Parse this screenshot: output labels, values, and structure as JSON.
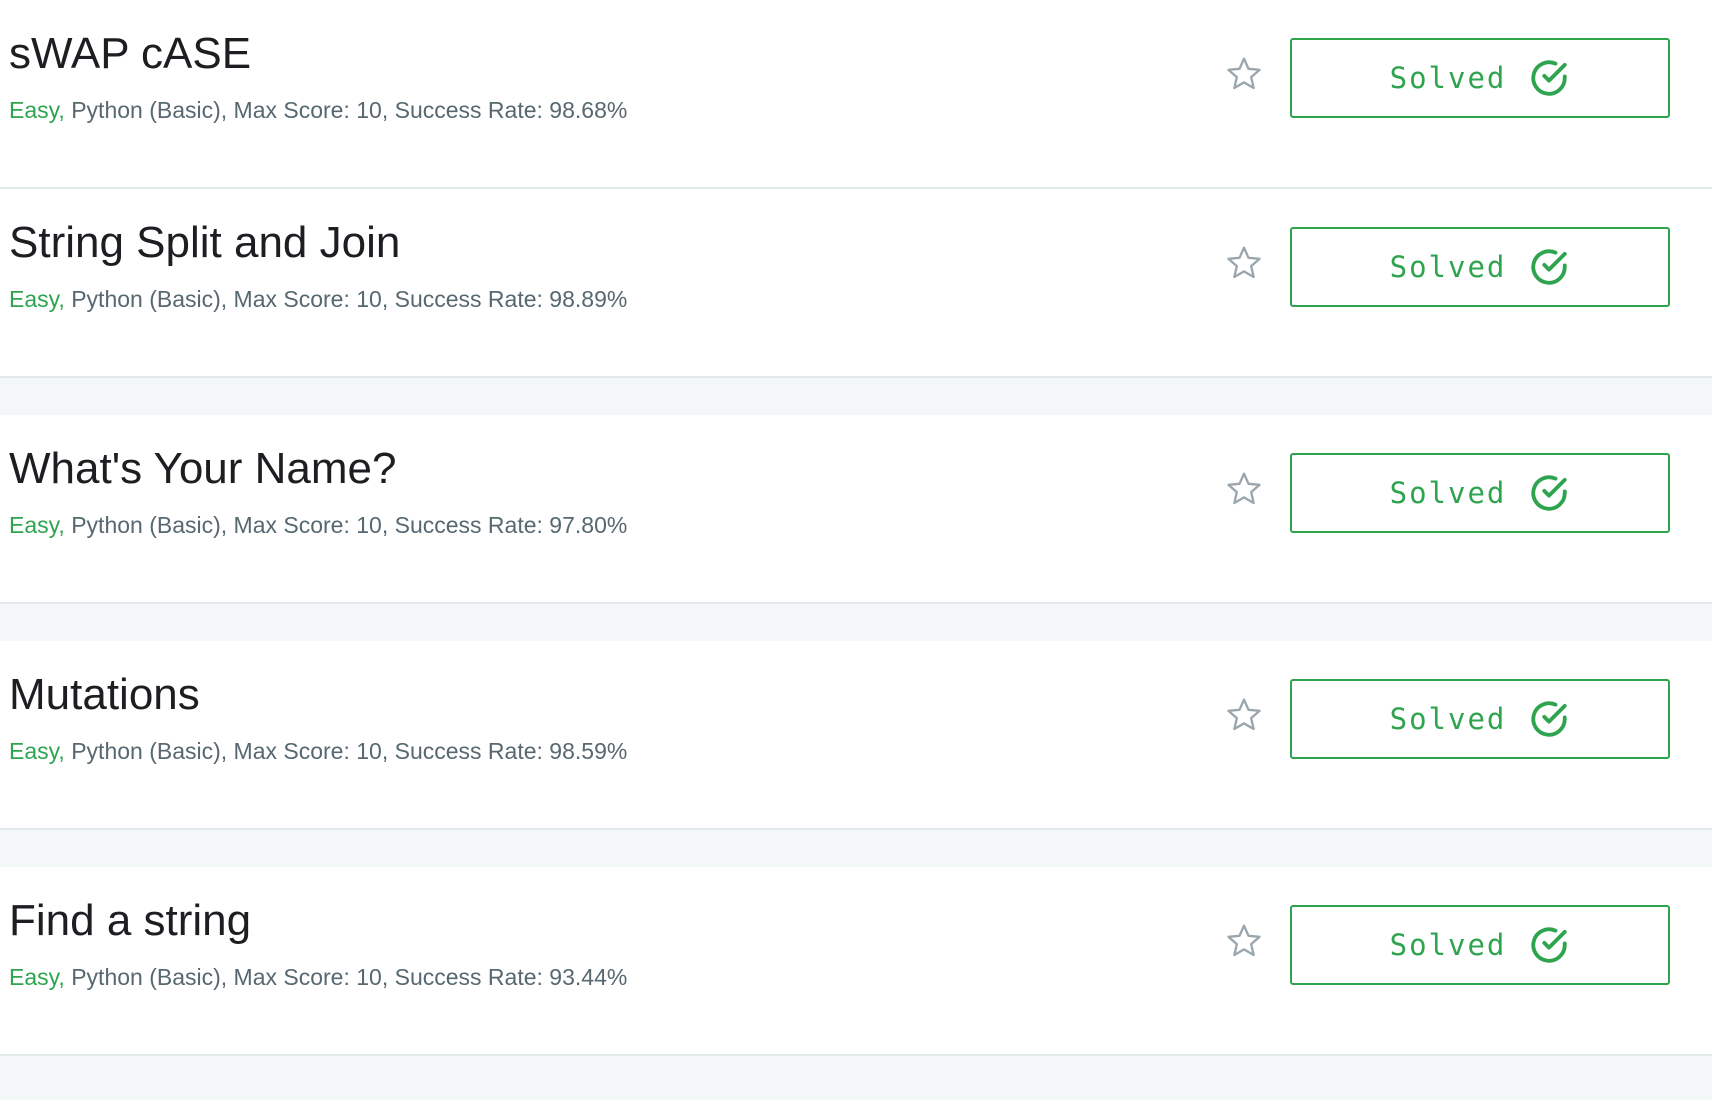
{
  "colors": {
    "accent_green": "#2ea44f",
    "title_text": "#1c1e21",
    "meta_text": "#576871",
    "star_outline": "#9aa6ad",
    "divider": "#e1e9ea"
  },
  "icons": {
    "bookmark": "star-outline-icon",
    "solved": "check-circle-icon"
  },
  "challenges": [
    {
      "title": "sWAP cASE",
      "difficulty": "Easy,",
      "details": " Python (Basic), Max Score: 10, Success Rate: 98.68%",
      "status_label": "Solved"
    },
    {
      "title": "String Split and Join",
      "difficulty": "Easy,",
      "details": " Python (Basic), Max Score: 10, Success Rate: 98.89%",
      "status_label": "Solved"
    },
    {
      "title": "What's Your Name?",
      "difficulty": "Easy,",
      "details": " Python (Basic), Max Score: 10, Success Rate: 97.80%",
      "status_label": "Solved"
    },
    {
      "title": "Mutations",
      "difficulty": "Easy,",
      "details": " Python (Basic), Max Score: 10, Success Rate: 98.59%",
      "status_label": "Solved"
    },
    {
      "title": "Find a string",
      "difficulty": "Easy,",
      "details": " Python (Basic), Max Score: 10, Success Rate: 93.44%",
      "status_label": "Solved"
    }
  ]
}
